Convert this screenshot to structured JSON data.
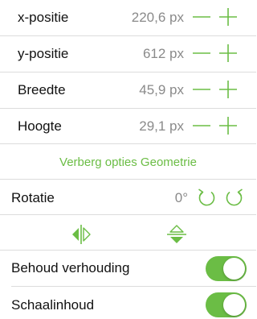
{
  "accent_color": "#6bbd45",
  "geometry": [
    {
      "label": "x-positie",
      "value": "220,6 px"
    },
    {
      "label": "y-positie",
      "value": "612 px"
    },
    {
      "label": "Breedte",
      "value": "45,9 px"
    },
    {
      "label": "Hoogte",
      "value": "29,1 px"
    }
  ],
  "toggle_geometry_label": "Verberg opties Geometrie",
  "rotation": {
    "label": "Rotatie",
    "value": "0°",
    "icons": [
      "rotate-left-icon",
      "rotate-right-icon"
    ]
  },
  "flip_icons": [
    "flip-horizontal-icon",
    "flip-vertical-icon"
  ],
  "switches": [
    {
      "label": "Behoud verhouding",
      "on": true
    },
    {
      "label": "Schaalinhoud",
      "on": true
    }
  ]
}
